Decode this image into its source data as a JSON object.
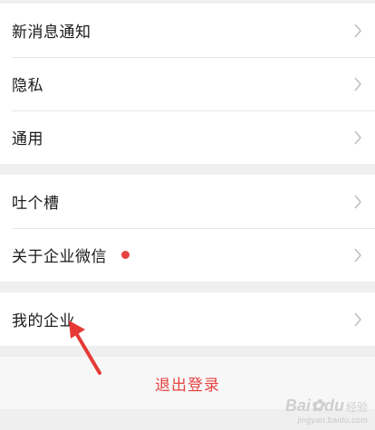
{
  "groups": [
    {
      "items": [
        {
          "label": "新消息通知"
        },
        {
          "label": "隐私"
        },
        {
          "label": "通用"
        }
      ]
    },
    {
      "items": [
        {
          "label": "吐个槽"
        },
        {
          "label": "关于企业微信",
          "badge": true
        }
      ]
    },
    {
      "items": [
        {
          "label": "我的企业"
        }
      ]
    }
  ],
  "logout": {
    "label": "退出登录"
  },
  "colors": {
    "badge": "#e64340",
    "logout_text": "#e64340",
    "annotation_arrow": "#e53a35"
  },
  "watermark": {
    "brand": "Bai",
    "brand_tail": "du",
    "jingyan": "经验",
    "url": "jingyan.baidu.com"
  },
  "icons": {
    "chevron": "chevron-right-icon",
    "arrow": "annotation-arrow"
  }
}
